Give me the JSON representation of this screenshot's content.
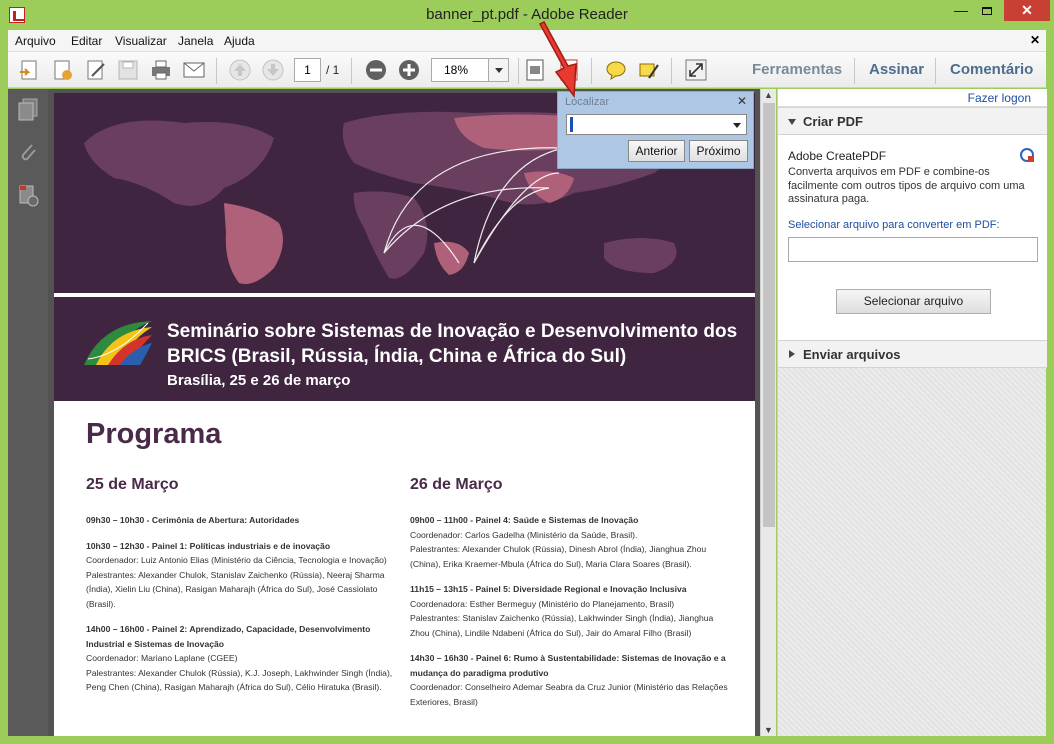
{
  "window": {
    "title": "banner_pt.pdf - Adobe Reader",
    "minimize": "—",
    "close": "✕"
  },
  "menu": {
    "items": [
      "Arquivo",
      "Editar",
      "Visualizar",
      "Janela",
      "Ajuda"
    ],
    "close": "✕"
  },
  "toolbar": {
    "page_current": "1",
    "page_total": "/ 1",
    "zoom": "18%",
    "links": [
      "Ferramentas",
      "Assinar",
      "Comentário"
    ]
  },
  "find": {
    "title": "Localizar",
    "close": "✕",
    "value": "",
    "prev_label": "Anterior",
    "next_label": "Próximo"
  },
  "document": {
    "banner_title": "Seminário sobre Sistemas de Inovação e Desenvolvimento dos BRICS (Brasil, Rússia, Índia, China e África do Sul)",
    "banner_sub": "Brasília, 25 e 26 de março",
    "program_title": "Programa",
    "days": [
      {
        "title": "25 de Março",
        "items": [
          {
            "head": "09h30 – 10h30 - Cerimônia de Abertura: Autoridades",
            "lines": []
          },
          {
            "head": "10h30 – 12h30 - Painel 1: Políticas industriais e de inovação",
            "lines": [
              "Coordenador: Luiz Antonio Elias (Ministério da Ciência, Tecnologia e Inovação)",
              "Palestrantes: Alexander Chulok, Stanislav Zaichenko (Rússia), Neeraj Sharma (Índia), Xielin Liu (China), Rasigan Maharajh (África do Sul), José Cassiolato (Brasil)."
            ]
          },
          {
            "head": "14h00 – 16h00 - Painel 2: Aprendizado, Capacidade, Desenvolvimento Industrial e Sistemas de Inovação",
            "lines": [
              "Coordenador: Mariano Laplane (CGEE)",
              "Palestrantes: Alexander Chulok (Rússia), K.J. Joseph, Lakhwinder Singh (Índia), Peng Chen (China), Rasigan Maharajh (África do Sul), Célio Hiratuka (Brasil)."
            ]
          }
        ]
      },
      {
        "title": "26 de Março",
        "items": [
          {
            "head": "09h00 – 11h00 - Painel 4: Saúde e Sistemas de Inovação",
            "lines": [
              "Coordenador: Carlos Gadelha (Ministério da Saúde, Brasil).",
              "Palestrantes: Alexander Chulok (Rússia), Dinesh Abrol (Índia), Jianghua Zhou (China), Erika Kraemer-Mbula (África do Sul), Maria Clara Soares (Brasil)."
            ]
          },
          {
            "head": "11h15 – 13h15 - Painel 5: Diversidade Regional e Inovação Inclusiva",
            "lines": [
              "Coordenadora: Esther Bermeguy (Ministério do Planejamento, Brasil)",
              "Palestrantes: Stanislav Zaichenko (Rússia), Lakhwinder Singh (Índia), Jianghua Zhou (China), Lindile Ndabeni (África do Sul), Jair do Amaral Filho (Brasil)"
            ]
          },
          {
            "head": "14h30 – 16h30 - Painel 6: Rumo à Sustentabilidade: Sistemas de Inovação e a mudança do paradigma produtivo",
            "lines": [
              "Coordenador: Conselheiro Ademar Seabra da Cruz Junior (Ministério das Relações Exteriores, Brasil)"
            ]
          }
        ]
      }
    ]
  },
  "right_pane": {
    "login": "Fazer logon",
    "create_header": "Criar PDF",
    "cp_title": "Adobe CreatePDF",
    "cp_desc": "Converta arquivos em PDF e combine-os facilmente com outros tipos de arquivo com uma assinatura paga.",
    "cp_label": "Selecionar arquivo para converter em PDF:",
    "cp_button": "Selecionar arquivo",
    "send_header": "Enviar arquivos"
  }
}
